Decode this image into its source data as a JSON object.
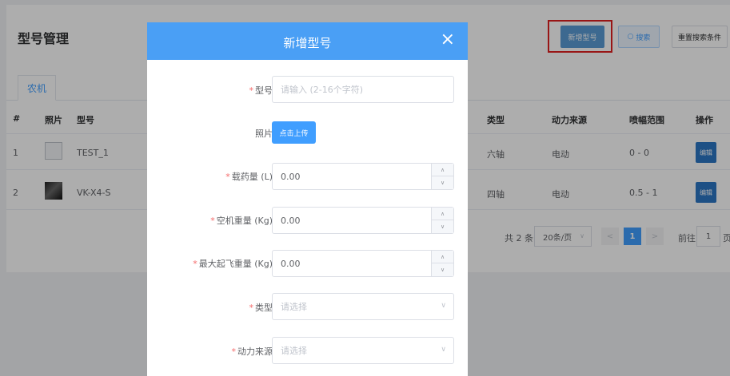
{
  "page": {
    "title": "型号管理",
    "buttons": {
      "add": "新增型号",
      "search": "搜索",
      "reset": "重置搜索条件"
    },
    "tabs": [
      {
        "label": "农机"
      }
    ],
    "table": {
      "headers": {
        "index": "#",
        "photo": "照片",
        "model": "型号",
        "type": "类型",
        "power": "动力来源",
        "range": "喷幅范围",
        "ops": "操作"
      },
      "rows": [
        {
          "index": "1",
          "model": "TEST_1",
          "type": "六轴",
          "power": "电动",
          "range": "0 - 0",
          "edit": "编辑"
        },
        {
          "index": "2",
          "model": "VK-X4-S",
          "type": "四轴",
          "power": "电动",
          "range": "0.5 - 1",
          "edit": "编辑"
        }
      ]
    },
    "pagination": {
      "total": "共 2 条",
      "page_size": "20条/页",
      "current": "1",
      "goto_label": "前往",
      "goto_value": "1",
      "goto_suffix": "页"
    }
  },
  "dialog": {
    "title": "新增型号",
    "close": "×",
    "fields": {
      "model": {
        "label": "型号",
        "placeholder": "请输入 (2-16个字符)"
      },
      "photo": {
        "label": "照片",
        "upload": "点击上传"
      },
      "load": {
        "label": "载药量 (L)",
        "value": "0.00"
      },
      "empty_weight": {
        "label": "空机重量 (Kg)",
        "value": "0.00"
      },
      "max_takeoff": {
        "label": "最大起飞重量 (Kg)",
        "value": "0.00"
      },
      "type": {
        "label": "类型",
        "placeholder": "请选择"
      },
      "power": {
        "label": "动力来源",
        "placeholder": "请选择"
      }
    }
  },
  "colors": {
    "accent": "#409eff",
    "header": "#4a9ff5",
    "highlight": "#e02020",
    "required": "#f56c6c"
  }
}
